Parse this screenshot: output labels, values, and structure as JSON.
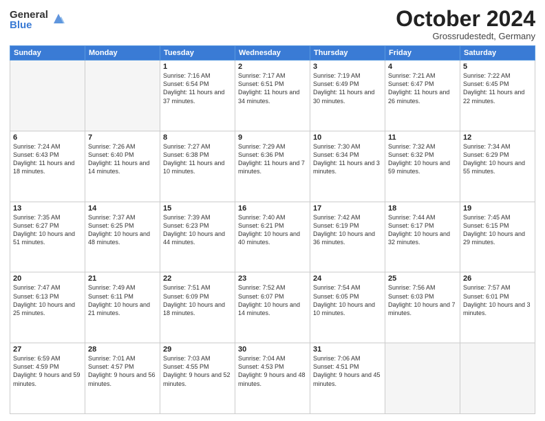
{
  "logo": {
    "general": "General",
    "blue": "Blue"
  },
  "title": "October 2024",
  "location": "Grossrudestedt, Germany",
  "headers": [
    "Sunday",
    "Monday",
    "Tuesday",
    "Wednesday",
    "Thursday",
    "Friday",
    "Saturday"
  ],
  "weeks": [
    [
      {
        "day": "",
        "info": ""
      },
      {
        "day": "",
        "info": ""
      },
      {
        "day": "1",
        "info": "Sunrise: 7:16 AM\nSunset: 6:54 PM\nDaylight: 11 hours and 37 minutes."
      },
      {
        "day": "2",
        "info": "Sunrise: 7:17 AM\nSunset: 6:51 PM\nDaylight: 11 hours and 34 minutes."
      },
      {
        "day": "3",
        "info": "Sunrise: 7:19 AM\nSunset: 6:49 PM\nDaylight: 11 hours and 30 minutes."
      },
      {
        "day": "4",
        "info": "Sunrise: 7:21 AM\nSunset: 6:47 PM\nDaylight: 11 hours and 26 minutes."
      },
      {
        "day": "5",
        "info": "Sunrise: 7:22 AM\nSunset: 6:45 PM\nDaylight: 11 hours and 22 minutes."
      }
    ],
    [
      {
        "day": "6",
        "info": "Sunrise: 7:24 AM\nSunset: 6:43 PM\nDaylight: 11 hours and 18 minutes."
      },
      {
        "day": "7",
        "info": "Sunrise: 7:26 AM\nSunset: 6:40 PM\nDaylight: 11 hours and 14 minutes."
      },
      {
        "day": "8",
        "info": "Sunrise: 7:27 AM\nSunset: 6:38 PM\nDaylight: 11 hours and 10 minutes."
      },
      {
        "day": "9",
        "info": "Sunrise: 7:29 AM\nSunset: 6:36 PM\nDaylight: 11 hours and 7 minutes."
      },
      {
        "day": "10",
        "info": "Sunrise: 7:30 AM\nSunset: 6:34 PM\nDaylight: 11 hours and 3 minutes."
      },
      {
        "day": "11",
        "info": "Sunrise: 7:32 AM\nSunset: 6:32 PM\nDaylight: 10 hours and 59 minutes."
      },
      {
        "day": "12",
        "info": "Sunrise: 7:34 AM\nSunset: 6:29 PM\nDaylight: 10 hours and 55 minutes."
      }
    ],
    [
      {
        "day": "13",
        "info": "Sunrise: 7:35 AM\nSunset: 6:27 PM\nDaylight: 10 hours and 51 minutes."
      },
      {
        "day": "14",
        "info": "Sunrise: 7:37 AM\nSunset: 6:25 PM\nDaylight: 10 hours and 48 minutes."
      },
      {
        "day": "15",
        "info": "Sunrise: 7:39 AM\nSunset: 6:23 PM\nDaylight: 10 hours and 44 minutes."
      },
      {
        "day": "16",
        "info": "Sunrise: 7:40 AM\nSunset: 6:21 PM\nDaylight: 10 hours and 40 minutes."
      },
      {
        "day": "17",
        "info": "Sunrise: 7:42 AM\nSunset: 6:19 PM\nDaylight: 10 hours and 36 minutes."
      },
      {
        "day": "18",
        "info": "Sunrise: 7:44 AM\nSunset: 6:17 PM\nDaylight: 10 hours and 32 minutes."
      },
      {
        "day": "19",
        "info": "Sunrise: 7:45 AM\nSunset: 6:15 PM\nDaylight: 10 hours and 29 minutes."
      }
    ],
    [
      {
        "day": "20",
        "info": "Sunrise: 7:47 AM\nSunset: 6:13 PM\nDaylight: 10 hours and 25 minutes."
      },
      {
        "day": "21",
        "info": "Sunrise: 7:49 AM\nSunset: 6:11 PM\nDaylight: 10 hours and 21 minutes."
      },
      {
        "day": "22",
        "info": "Sunrise: 7:51 AM\nSunset: 6:09 PM\nDaylight: 10 hours and 18 minutes."
      },
      {
        "day": "23",
        "info": "Sunrise: 7:52 AM\nSunset: 6:07 PM\nDaylight: 10 hours and 14 minutes."
      },
      {
        "day": "24",
        "info": "Sunrise: 7:54 AM\nSunset: 6:05 PM\nDaylight: 10 hours and 10 minutes."
      },
      {
        "day": "25",
        "info": "Sunrise: 7:56 AM\nSunset: 6:03 PM\nDaylight: 10 hours and 7 minutes."
      },
      {
        "day": "26",
        "info": "Sunrise: 7:57 AM\nSunset: 6:01 PM\nDaylight: 10 hours and 3 minutes."
      }
    ],
    [
      {
        "day": "27",
        "info": "Sunrise: 6:59 AM\nSunset: 4:59 PM\nDaylight: 9 hours and 59 minutes."
      },
      {
        "day": "28",
        "info": "Sunrise: 7:01 AM\nSunset: 4:57 PM\nDaylight: 9 hours and 56 minutes."
      },
      {
        "day": "29",
        "info": "Sunrise: 7:03 AM\nSunset: 4:55 PM\nDaylight: 9 hours and 52 minutes."
      },
      {
        "day": "30",
        "info": "Sunrise: 7:04 AM\nSunset: 4:53 PM\nDaylight: 9 hours and 48 minutes."
      },
      {
        "day": "31",
        "info": "Sunrise: 7:06 AM\nSunset: 4:51 PM\nDaylight: 9 hours and 45 minutes."
      },
      {
        "day": "",
        "info": ""
      },
      {
        "day": "",
        "info": ""
      }
    ]
  ]
}
